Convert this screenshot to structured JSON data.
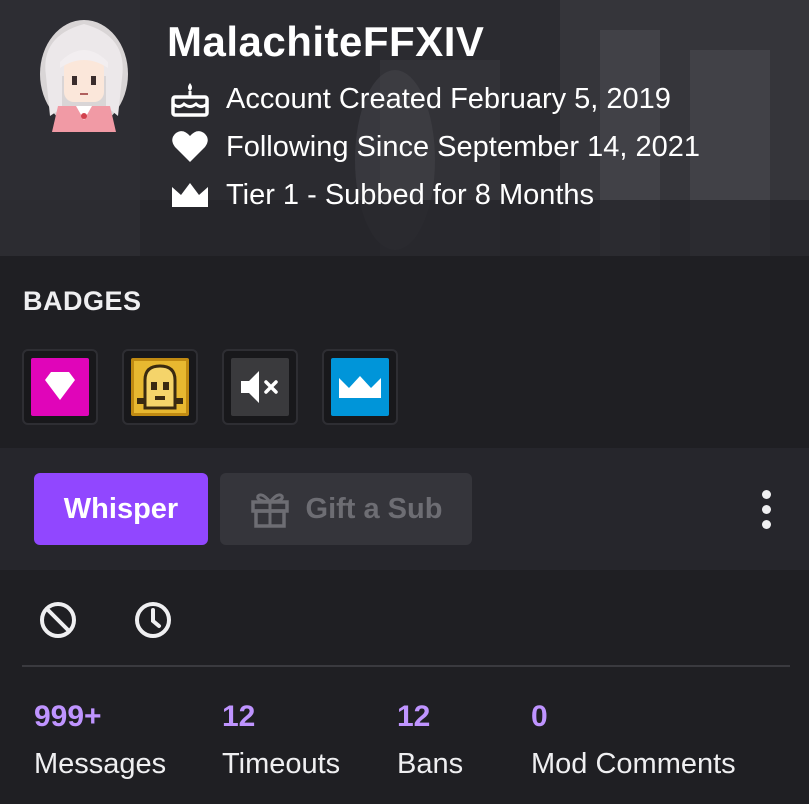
{
  "profile": {
    "username": "MalachiteFFXIV",
    "account_created": "Account Created February 5, 2019",
    "following_since": "Following Since September 14, 2021",
    "subscription": "Tier 1 - Subbed for 8 Months"
  },
  "badges": {
    "title": "BADGES",
    "items": [
      {
        "icon": "diamond-badge-icon",
        "color": "#e005b9"
      },
      {
        "icon": "pixel-character-badge-icon",
        "color": "#d4a017"
      },
      {
        "icon": "muted-speaker-badge-icon",
        "color": "#3a3a3d"
      },
      {
        "icon": "crown-badge-icon",
        "color": "#0095d9"
      }
    ]
  },
  "actions": {
    "whisper_label": "Whisper",
    "gift_label": "Gift a Sub",
    "more_icon": "vertical-dots-icon"
  },
  "mod_tools": {
    "ban_icon": "ban-icon",
    "timeout_icon": "clock-icon"
  },
  "stats": [
    {
      "value": "999+",
      "label": "Messages"
    },
    {
      "value": "12",
      "label": "Timeouts"
    },
    {
      "value": "12",
      "label": "Bans"
    },
    {
      "value": "0",
      "label": "Mod Comments"
    }
  ],
  "colors": {
    "accent": "#9147ff",
    "stat_value": "#bf94ff",
    "background": "#18181b"
  }
}
